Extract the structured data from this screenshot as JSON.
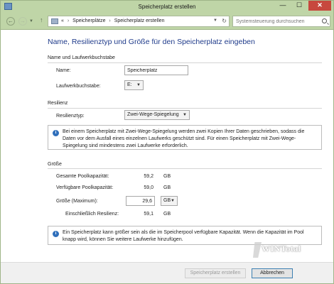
{
  "window": {
    "title": "Speicherplatz erstellen",
    "controls": {
      "minimize": "—",
      "maximize": "☐",
      "close": "✕"
    }
  },
  "address": {
    "prefix": "«",
    "crumbs": [
      "Speicherplätze",
      "Speicherplatz erstellen"
    ],
    "separator": "›",
    "search_placeholder": "Systemsteuerung durchsuchen"
  },
  "heading": "Name, Resilienztyp und Größe für den Speicherplatz eingeben",
  "section_name": {
    "title": "Name und Laufwerkbuchstabe",
    "name_label": "Name:",
    "name_value": "Speicherplatz",
    "drive_label": "Laufwerkbuchstabe:",
    "drive_value": "E:"
  },
  "section_resilience": {
    "title": "Resilienz",
    "type_label": "Resilienztyp:",
    "type_value": "Zwei-Wege-Spiegelung",
    "info": "Bei einem Speicherplatz mit Zwei-Wege-Spiegelung werden zwei Kopien Ihrer Daten geschrieben, sodass die Daten vor dem Ausfall eines einzelnen Laufwerks geschützt sind. Für einen Speicherplatz mit Zwei-Wege-Spiegelung sind mindestens zwei Laufwerke erforderlich."
  },
  "section_size": {
    "title": "Größe",
    "total_label": "Gesamte Poolkapazität:",
    "total_value": "59,2",
    "total_unit": "GB",
    "avail_label": "Verfügbare Poolkapazität:",
    "avail_value": "59,0",
    "avail_unit": "GB",
    "max_label": "Größe (Maximum):",
    "max_value": "29,6",
    "max_unit": "GB",
    "incl_label": "Einschließlich Resilienz:",
    "incl_value": "59,1",
    "incl_unit": "GB",
    "info": "Ein Speicherplatz kann größer sein als die im Speicherpool verfügbare Kapazität. Wenn die Kapazität im Pool knapp wird, können Sie weitere Laufwerke hinzufügen."
  },
  "buttons": {
    "create": "Speicherplatz erstellen",
    "cancel": "Abbrechen"
  },
  "watermark": "WINTotal"
}
